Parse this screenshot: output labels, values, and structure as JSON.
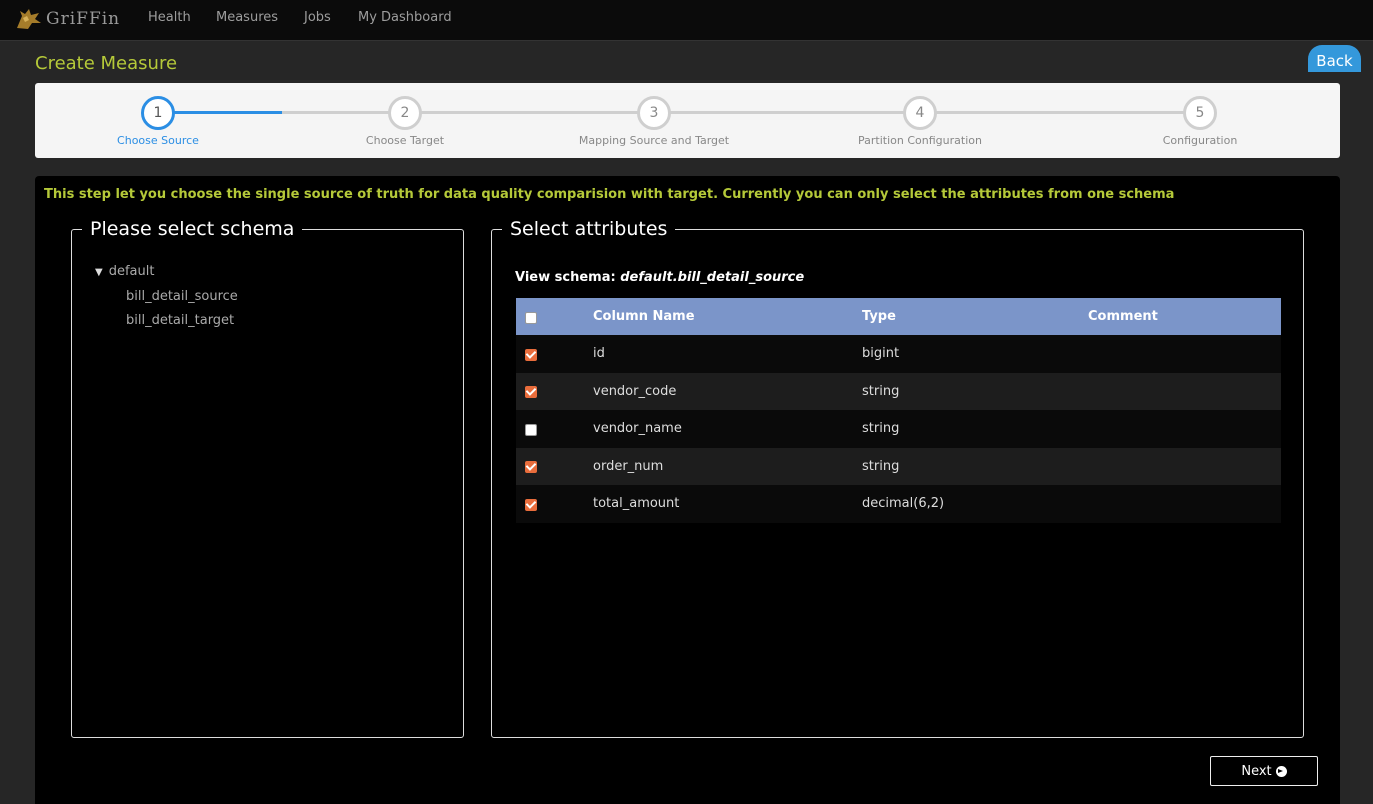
{
  "nav": {
    "brand": "GriFFin",
    "links": [
      "Health",
      "Measures",
      "Jobs",
      "My Dashboard"
    ]
  },
  "page_title": "Create Measure",
  "back_label": "Back",
  "steps": [
    {
      "number": "1",
      "label": "Choose Source",
      "active": true
    },
    {
      "number": "2",
      "label": "Choose Target",
      "active": false
    },
    {
      "number": "3",
      "label": "Mapping Source and Target",
      "active": false
    },
    {
      "number": "4",
      "label": "Partition Configuration",
      "active": false
    },
    {
      "number": "5",
      "label": "Configuration",
      "active": false
    }
  ],
  "info_text": "This step let you choose the single source of truth for data quality comparision with target. Currently you can only select the attributes from one schema",
  "schema_panel": {
    "legend": "Please select schema",
    "root": "default",
    "tables": [
      "bill_detail_source",
      "bill_detail_target"
    ]
  },
  "attr_panel": {
    "legend": "Select attributes",
    "view_label": "View schema:",
    "view_value": "default.bill_detail_source",
    "headers": {
      "column": "Column Name",
      "type": "Type",
      "comment": "Comment"
    },
    "select_all_checked": false,
    "rows": [
      {
        "checked": true,
        "name": "id",
        "type": "bigint",
        "comment": ""
      },
      {
        "checked": true,
        "name": "vendor_code",
        "type": "string",
        "comment": ""
      },
      {
        "checked": false,
        "name": "vendor_name",
        "type": "string",
        "comment": ""
      },
      {
        "checked": true,
        "name": "order_num",
        "type": "string",
        "comment": ""
      },
      {
        "checked": true,
        "name": "total_amount",
        "type": "decimal(6,2)",
        "comment": ""
      }
    ]
  },
  "next_label": "Next",
  "colors": {
    "accent": "#b5c939",
    "step_active": "#2b8ee4",
    "back_button": "#3498db",
    "table_header": "#7b95c9",
    "checkbox_checked": "#e96d3c"
  }
}
